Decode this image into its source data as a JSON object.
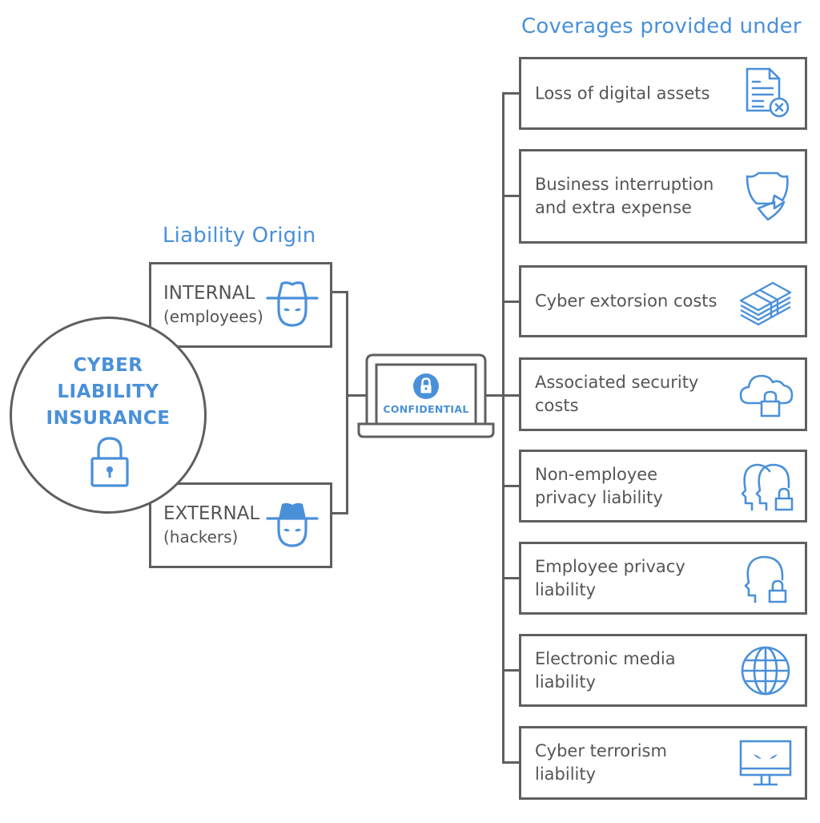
{
  "headings": {
    "coverages": "Coverages provided under",
    "origin": "Liability Origin"
  },
  "center": {
    "title": "CYBER\nLIABILITY\nINSURANCE",
    "icon": "padlock-icon"
  },
  "origins": [
    {
      "title": "INTERNAL",
      "subtitle": "(employees)",
      "icon": "hacker-outline-icon"
    },
    {
      "title": "EXTERNAL",
      "subtitle": "(hackers)",
      "icon": "hacker-filled-icon"
    }
  ],
  "laptop": {
    "label": "CONFIDENTIAL",
    "icon": "lock-badge-icon"
  },
  "coverages": [
    {
      "label": "Loss of digital assets",
      "icon": "document-x-icon"
    },
    {
      "label": "Business interruption\nand extra expense",
      "icon": "broken-shield-icon"
    },
    {
      "label": "Cyber extorsion costs",
      "icon": "money-stack-icon"
    },
    {
      "label": "Associated security\ncosts",
      "icon": "cloud-lock-icon"
    },
    {
      "label": "Non-employee\nprivacy liability",
      "icon": "two-heads-lock-icon"
    },
    {
      "label": "Employee privacy\nliability",
      "icon": "head-lock-icon"
    },
    {
      "label": "Electronic media\nliability",
      "icon": "globe-icon"
    },
    {
      "label": "Cyber terrorism\nliability",
      "icon": "evil-monitor-icon"
    }
  ],
  "colors": {
    "accent": "#4a90d9",
    "stroke": "#5f5f5f",
    "text": "#555555"
  }
}
